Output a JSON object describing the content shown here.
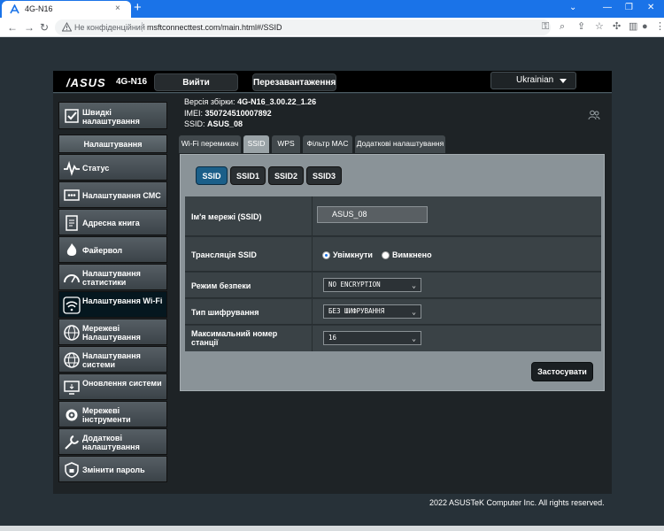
{
  "browser": {
    "tab_title": "4G-N16",
    "tab_close": "×",
    "new_tab": "+",
    "security_label": "Не конфіденційний",
    "url": "msftconnecttest.com/main.html#/SSID",
    "icons": [
      "back-icon",
      "forward-icon",
      "reload-icon",
      "not-secure-icon",
      "key-icon",
      "zoom-icon",
      "share-icon",
      "star-icon",
      "puzzle-icon",
      "sidebar-icon",
      "profile-icon",
      "menu-icon"
    ]
  },
  "header": {
    "logo": "/ASUS",
    "model": "4G-N16",
    "logout_label": "Вийти",
    "reboot_label": "Перезавантаження",
    "language": "Ukrainian"
  },
  "sidebar": {
    "quick_setup": "Швидкі налаштування",
    "section_title": "Налаштування",
    "items": [
      {
        "label": "Статус",
        "icon": "status-icon"
      },
      {
        "label": "Налаштування СМС",
        "icon": "sms-icon"
      },
      {
        "label": "Адресна книга",
        "icon": "address-book-icon"
      },
      {
        "label": "Файервол",
        "icon": "firewall-icon"
      },
      {
        "label": "Налаштування статистики",
        "icon": "statistics-icon"
      },
      {
        "label": "Налаштування Wi-Fi",
        "icon": "wifi-icon"
      },
      {
        "label": "Мережеві Налаштування",
        "icon": "network-settings-icon"
      },
      {
        "label": "Налаштування системи",
        "icon": "system-settings-icon"
      },
      {
        "label": "Оновлення системи",
        "icon": "system-update-icon"
      },
      {
        "label": "Мережеві інструменти",
        "icon": "network-tools-icon"
      },
      {
        "label": "Додаткові налаштування",
        "icon": "advanced-settings-icon"
      },
      {
        "label": "Змінити пароль",
        "icon": "change-password-icon"
      }
    ]
  },
  "info": {
    "version_label": "Версія збірки:",
    "version_value": "4G-N16_3.00.22_1.26",
    "imei_label": "IMEI:",
    "imei_value": "350724510007892",
    "ssid_label": "SSID:",
    "ssid_value": "ASUS_08"
  },
  "tabs": [
    "Wi-Fi перемикач",
    "SSID",
    "WPS",
    "Фільтр MAC",
    "Додаткові налаштування"
  ],
  "ssid_buttons": [
    "SSID",
    "SSID1",
    "SSID2",
    "SSID3"
  ],
  "form": {
    "ssid_name_label": "Ім'я мережі (SSID)",
    "ssid_name_value": "ASUS_08",
    "broadcast_label": "Трансляція SSID",
    "broadcast_on": "Увімкнути",
    "broadcast_off": "Вимкнено",
    "security_label": "Режим безпеки",
    "security_value": "NO ENCRYPTION",
    "encryption_label": "Тип шифрування",
    "encryption_value": "БЕЗ ШИФРУВАННЯ",
    "max_stations_label": "Максимальний номер станції",
    "max_stations_value": "16",
    "apply_label": "Застосувати"
  },
  "footer": "2022 ASUSTeK Computer Inc. All rights reserved."
}
